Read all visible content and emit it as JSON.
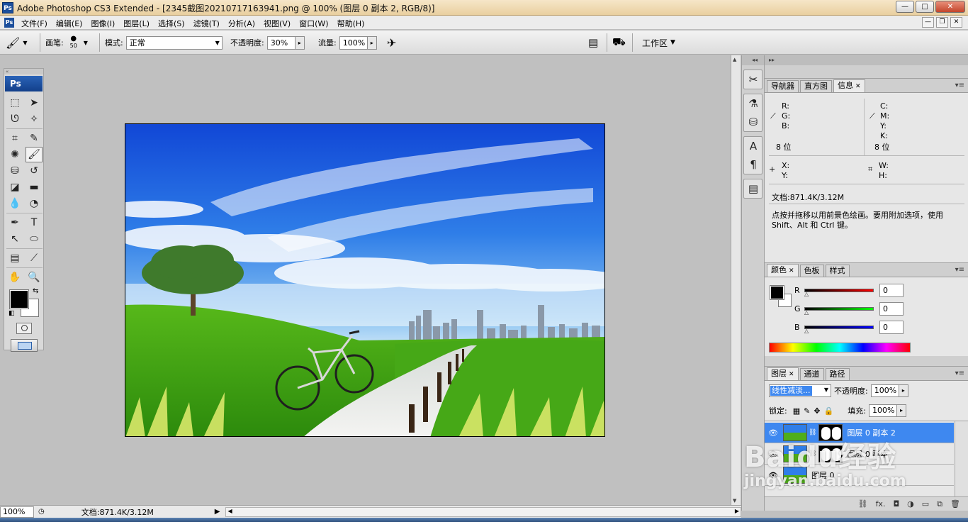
{
  "window": {
    "title": "Adobe Photoshop CS3 Extended - [2345截图20210717163941.png @ 100% (图层 0 副本 2, RGB/8)]",
    "app_icon": "Ps",
    "min": "—",
    "max": "□",
    "close": "✕"
  },
  "menu": {
    "items": [
      "文件(F)",
      "编辑(E)",
      "图像(I)",
      "图层(L)",
      "选择(S)",
      "滤镜(T)",
      "分析(A)",
      "视图(V)",
      "窗口(W)",
      "帮助(H)"
    ],
    "doc_min": "—",
    "doc_max": "❐",
    "doc_close": "✕"
  },
  "options": {
    "brush_label": "画笔:",
    "brush_size": "50",
    "mode_label": "模式:",
    "mode_value": "正常",
    "opacity_label": "不透明度:",
    "opacity_value": "30%",
    "flow_label": "流量:",
    "flow_value": "100%",
    "workspace_label": "工作区"
  },
  "tools": {
    "header": "Ps",
    "grip": "«",
    "items": [
      {
        "glyph": "⬚",
        "name": "marquee-tool-icon"
      },
      {
        "glyph": "➤",
        "name": "move-tool-icon"
      },
      {
        "glyph": "ᘎ",
        "name": "lasso-tool-icon"
      },
      {
        "glyph": "✧",
        "name": "magic-wand-tool-icon"
      },
      {
        "glyph": "⌗",
        "name": "crop-tool-icon"
      },
      {
        "glyph": "✎",
        "name": "slice-tool-icon"
      },
      {
        "glyph": "✺",
        "name": "healing-brush-tool-icon"
      },
      {
        "glyph": "🖌",
        "name": "brush-tool-icon"
      },
      {
        "glyph": "⛁",
        "name": "clone-stamp-tool-icon"
      },
      {
        "glyph": "↺",
        "name": "history-brush-tool-icon"
      },
      {
        "glyph": "◪",
        "name": "eraser-tool-icon"
      },
      {
        "glyph": "▬",
        "name": "gradient-tool-icon"
      },
      {
        "glyph": "💧",
        "name": "blur-tool-icon"
      },
      {
        "glyph": "◔",
        "name": "dodge-tool-icon"
      },
      {
        "glyph": "✒",
        "name": "pen-tool-icon"
      },
      {
        "glyph": "T",
        "name": "type-tool-icon"
      },
      {
        "glyph": "↖",
        "name": "path-selection-tool-icon"
      },
      {
        "glyph": "⬭",
        "name": "shape-tool-icon"
      },
      {
        "glyph": "▤",
        "name": "notes-tool-icon"
      },
      {
        "glyph": "⟋",
        "name": "eyedropper-tool-icon"
      },
      {
        "glyph": "✋",
        "name": "hand-tool-icon"
      },
      {
        "glyph": "🔍",
        "name": "zoom-tool-icon"
      }
    ]
  },
  "colors": {
    "foreground": "#000000",
    "background": "#ffffff",
    "accent": "#3e88f0"
  },
  "panels": {
    "info": {
      "tabs": [
        "导航器",
        "直方图",
        "信息"
      ],
      "r": "R:",
      "g": "G:",
      "b": "B:",
      "c": "C:",
      "m": "M:",
      "y": "Y:",
      "k": "K:",
      "bits_left": "8 位",
      "bits_right": "8 位",
      "x": "X:",
      "y2": "Y:",
      "w": "W:",
      "h": "H:",
      "doc": "文档:871.4K/3.12M",
      "hint": "点按并拖移以用前景色绘画。要用附加选项，使用 Shift、Alt 和 Ctrl 键。"
    },
    "color": {
      "tabs": [
        "颜色",
        "色板",
        "样式"
      ],
      "r_label": "R",
      "g_label": "G",
      "b_label": "B",
      "r_value": "0",
      "g_value": "0",
      "b_value": "0"
    },
    "layers": {
      "tabs": [
        "图层",
        "通道",
        "路径"
      ],
      "blend_mode": "线性减淡...",
      "opacity_label": "不透明度:",
      "opacity_value": "100%",
      "lock_label": "锁定:",
      "fill_label": "填充:",
      "fill_value": "100%",
      "items": [
        {
          "name": "图层 0 副本 2",
          "selected": true,
          "has_mask": true
        },
        {
          "name": "图层 0 副本",
          "selected": false,
          "has_mask": true
        },
        {
          "name": "图层 0",
          "selected": false,
          "has_mask": false
        }
      ],
      "bottom_icons": [
        "⛓",
        "fx.",
        "◘",
        "◑",
        "▭",
        "⧉",
        "🗑"
      ]
    }
  },
  "status": {
    "zoom": "100%",
    "doc": "文档:871.4K/3.12M"
  },
  "watermark": {
    "logo_text": "Baidu经验",
    "url": "jingyan.baidu.com"
  }
}
